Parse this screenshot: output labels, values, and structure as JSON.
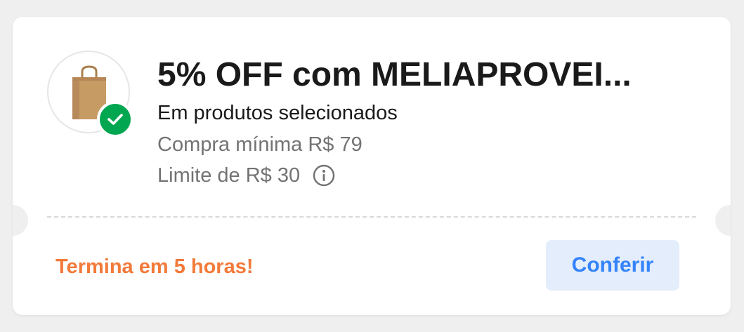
{
  "coupon": {
    "title": "5% OFF com MELIAPROVEI...",
    "subtitle": "Em produtos selecionados",
    "min_purchase": "Compra mínima R$ 79",
    "limit": "Limite de R$ 30",
    "expiry": "Termina em 5 horas!",
    "cta_label": "Conferir",
    "icons": {
      "product": "shopping-bag-icon",
      "status": "check-icon",
      "info": "info-icon"
    },
    "colors": {
      "accent_orange": "#f27a3a",
      "cta_text": "#3483fa",
      "cta_bg": "#e3edfb",
      "check_green": "#00a650"
    }
  }
}
